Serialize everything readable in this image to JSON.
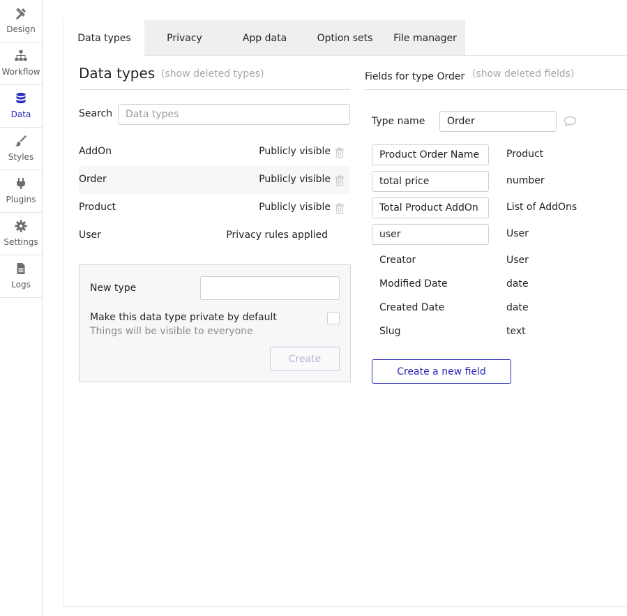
{
  "sidebar": {
    "items": [
      {
        "label": "Design",
        "icon": "design-icon"
      },
      {
        "label": "Workflow",
        "icon": "workflow-icon"
      },
      {
        "label": "Data",
        "icon": "database-icon",
        "active": true
      },
      {
        "label": "Styles",
        "icon": "brush-icon"
      },
      {
        "label": "Plugins",
        "icon": "plug-icon"
      },
      {
        "label": "Settings",
        "icon": "gear-icon"
      },
      {
        "label": "Logs",
        "icon": "document-icon"
      }
    ]
  },
  "tabs": [
    "Data types",
    "Privacy",
    "App data",
    "Option sets",
    "File manager"
  ],
  "left": {
    "title": "Data types",
    "show_deleted": "(show deleted types)",
    "search_label": "Search",
    "search_placeholder": "Data types",
    "types": [
      {
        "name": "AddOn",
        "status": "Publicly visible"
      },
      {
        "name": "Order",
        "status": "Publicly visible"
      },
      {
        "name": "Product",
        "status": "Publicly visible"
      },
      {
        "name": "User",
        "status": "Privacy rules applied"
      }
    ],
    "new_type": {
      "label": "New type",
      "value": "",
      "private_label": "Make this data type private by default",
      "private_hint": "Things will be visible to everyone",
      "create_label": "Create"
    }
  },
  "right": {
    "title": "Fields for type Order",
    "show_deleted": "(show deleted fields)",
    "type_name_label": "Type name",
    "type_name_value": "Order",
    "custom_fields": [
      {
        "name": "Product Order Name",
        "type": "Product"
      },
      {
        "name": "total price",
        "type": "number"
      },
      {
        "name": "Total Product AddOn",
        "type": "List of AddOns"
      },
      {
        "name": "user",
        "type": "User"
      }
    ],
    "builtin_fields": [
      {
        "name": "Creator",
        "type": "User"
      },
      {
        "name": "Modified Date",
        "type": "date"
      },
      {
        "name": "Created Date",
        "type": "date"
      },
      {
        "name": "Slug",
        "type": "text"
      }
    ],
    "new_field_label": "Create a new field"
  },
  "colors": {
    "accent": "#2b2bb8",
    "muted": "#a8a8a8",
    "border": "#dadada"
  }
}
